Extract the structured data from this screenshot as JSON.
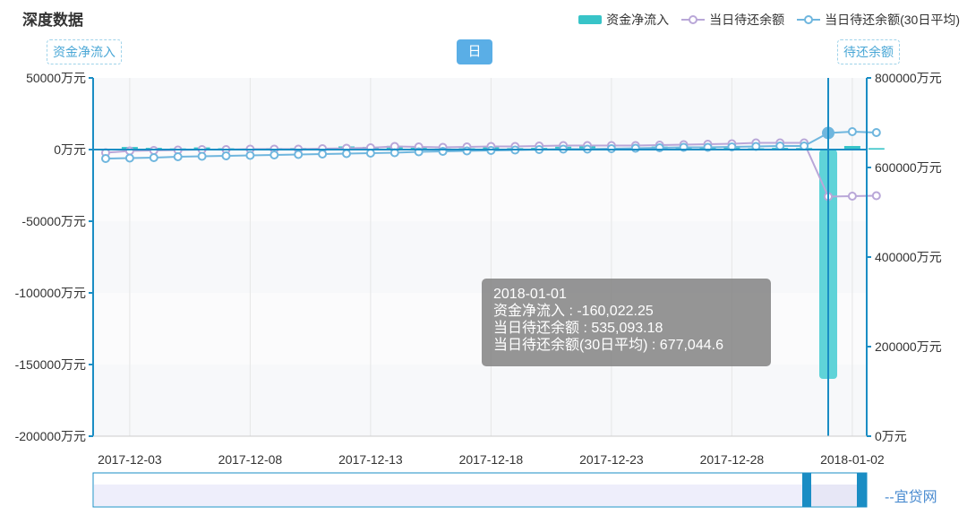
{
  "title": "深度数据",
  "legend": {
    "bar_label": "资金净流入",
    "line1_label": "当日待还余额",
    "line2_label": "当日待还余额(30日平均)"
  },
  "buttons": {
    "left": "资金净流入",
    "center": "日",
    "right": "待还余额"
  },
  "colors": {
    "bar": "#5fd3d8",
    "line1": "#b9a7d8",
    "line2": "#6fb6de",
    "axis": "#1a8dc4"
  },
  "tooltip": {
    "date": "2018-01-01",
    "line1": "资金净流入 : -160,022.25",
    "line2": "当日待还余额 : 535,093.18",
    "line3": "当日待还余额(30日平均) : 677,044.6"
  },
  "watermark": "--宜贷网",
  "chart_data": {
    "type": "bar+line",
    "x": [
      "2017-12-02",
      "2017-12-03",
      "2017-12-04",
      "2017-12-05",
      "2017-12-06",
      "2017-12-07",
      "2017-12-08",
      "2017-12-09",
      "2017-12-10",
      "2017-12-11",
      "2017-12-12",
      "2017-12-13",
      "2017-12-14",
      "2017-12-15",
      "2017-12-16",
      "2017-12-17",
      "2017-12-18",
      "2017-12-19",
      "2017-12-20",
      "2017-12-21",
      "2017-12-22",
      "2017-12-23",
      "2017-12-24",
      "2017-12-25",
      "2017-12-26",
      "2017-12-27",
      "2017-12-28",
      "2017-12-29",
      "2017-12-30",
      "2017-12-31",
      "2018-01-01",
      "2018-01-02",
      "2018-01-03"
    ],
    "x_tick_labels": [
      "2017-12-03",
      "2017-12-08",
      "2017-12-13",
      "2017-12-18",
      "2017-12-23",
      "2017-12-28",
      "2018-01-02"
    ],
    "y_left": {
      "ticks": [
        "50000万元",
        "0万元",
        "-50000万元",
        "-100000万元",
        "-150000万元",
        "-200000万元"
      ],
      "ylim": [
        -200000,
        50000
      ]
    },
    "y_right": {
      "ticks": [
        "800000万元",
        "600000万元",
        "400000万元",
        "200000万元",
        "0万元"
      ],
      "ylim": [
        0,
        800000
      ]
    },
    "series": [
      {
        "name": "资金净流入",
        "axis": "left",
        "type": "bar",
        "values": [
          500,
          1800,
          1200,
          800,
          1500,
          900,
          600,
          1000,
          1100,
          400,
          2200,
          1900,
          2600,
          1300,
          700,
          900,
          1800,
          1000,
          1200,
          2000,
          2300,
          800,
          900,
          2100,
          1400,
          2000,
          1500,
          900,
          1200,
          1100,
          -160022.25,
          2500,
          1000
        ]
      },
      {
        "name": "当日待还余额",
        "axis": "right",
        "type": "line",
        "values": [
          633000,
          637000,
          638000,
          639000,
          640000,
          640000,
          641000,
          641000,
          641000,
          642000,
          643000,
          644000,
          647000,
          646000,
          645000,
          646000,
          647000,
          647000,
          648000,
          649000,
          649000,
          649000,
          649000,
          650000,
          651000,
          652000,
          653000,
          655000,
          655000,
          655000,
          535093.18,
          536000,
          537000
        ]
      },
      {
        "name": "当日待还余额(30日平均)",
        "axis": "right",
        "type": "line",
        "values": [
          620000,
          621000,
          622000,
          624000,
          625000,
          626000,
          627000,
          628000,
          629000,
          630000,
          631000,
          632000,
          633000,
          635000,
          636000,
          637000,
          638000,
          639000,
          640000,
          641000,
          641000,
          642000,
          643000,
          644000,
          645000,
          645000,
          646000,
          647000,
          648000,
          648000,
          677044.6,
          680000,
          678000
        ]
      }
    ],
    "grid": true,
    "legend_position": "top-right",
    "highlight_index": 30
  }
}
